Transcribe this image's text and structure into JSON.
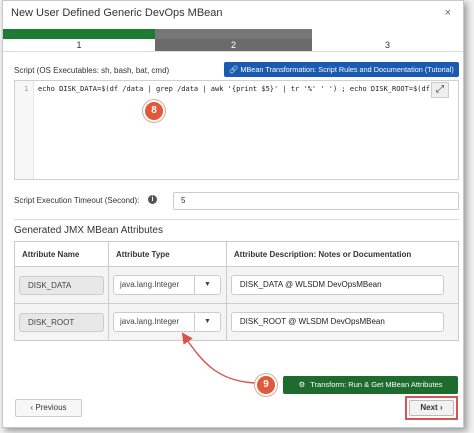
{
  "window": {
    "title": "New User Defined Generic DevOps MBean",
    "close_glyph": "×"
  },
  "wizard": {
    "steps": [
      "1",
      "2",
      "3"
    ],
    "active_step": "2"
  },
  "script": {
    "label": "Script (OS Executables: sh, bash, bat, cmd)",
    "tutorial_button": "MBean Transformation: Script Rules and Documentation (Tutorial)",
    "line_number": "1",
    "code": "echo DISK_DATA=$(df /data | grep /data | awk '{print $5}' | tr '%' ' ') ; echo DISK_ROOT=$(df /",
    "expand_glyph": "⤢"
  },
  "timeout": {
    "label": "Script Execution Timeout (Second):",
    "value": "5",
    "info_glyph": "i"
  },
  "attributes": {
    "title": "Generated JMX MBean Attributes",
    "headers": [
      "Attribute Name",
      "Attribute Type",
      "Attribute Description: Notes or Documentation"
    ],
    "rows": [
      {
        "name": "DISK_DATA",
        "type": "java.lang.Integer",
        "description": "DISK_DATA @ WLSDM DevOpsMBean"
      },
      {
        "name": "DISK_ROOT",
        "type": "java.lang.Integer",
        "description": "DISK_ROOT @ WLSDM DevOpsMBean"
      }
    ]
  },
  "actions": {
    "transform": "Transform: Run & Get MBean Attributes",
    "previous": "Previous",
    "next": "Next",
    "previous_glyph": "‹",
    "next_glyph": "›"
  },
  "annotations": {
    "badge_8": "8",
    "badge_9": "9"
  },
  "colors": {
    "primary_green": "#1e7b33",
    "step_gray": "#777777",
    "tutorial_blue": "#1a5ab0",
    "badge_orange": "#de5a3a",
    "arrow_red": "#d9534f",
    "highlight_red": "#d9534f"
  }
}
